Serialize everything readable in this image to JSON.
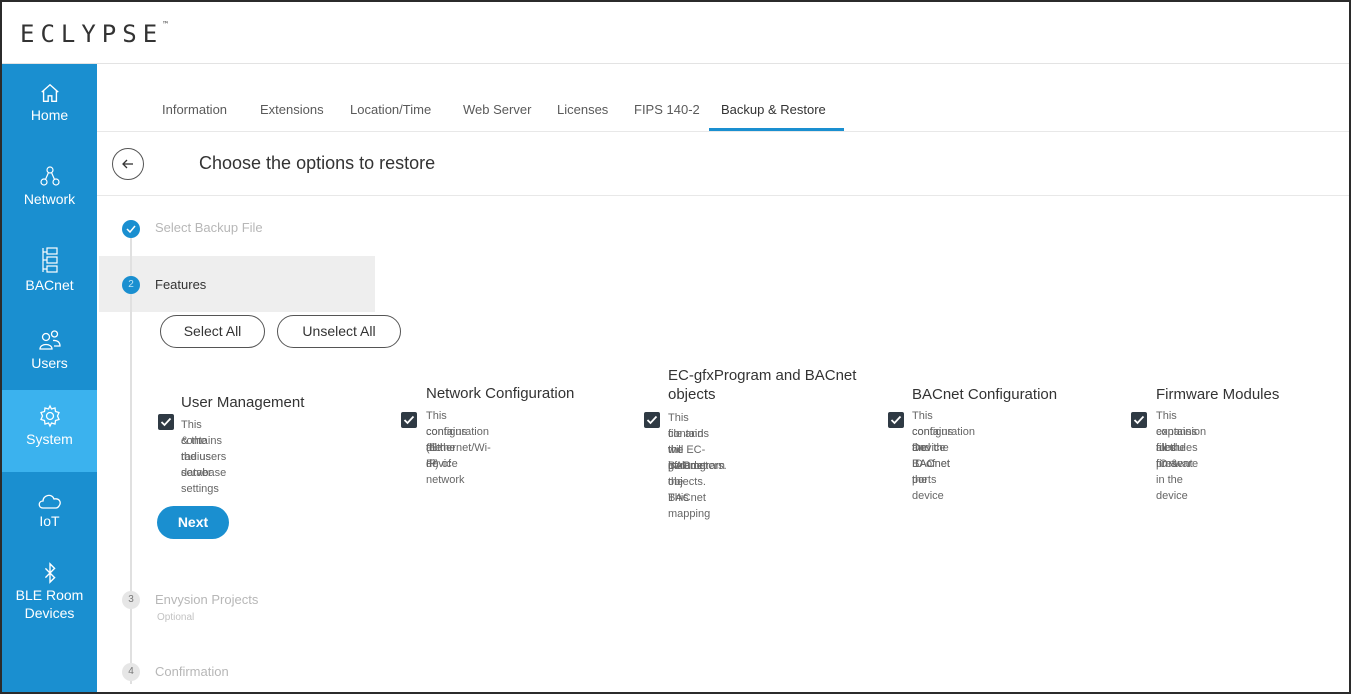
{
  "app": {
    "logo": "ECLYPSE",
    "logo_tm": "™"
  },
  "sidebar": {
    "items": [
      {
        "label": "Home"
      },
      {
        "label": "Network"
      },
      {
        "label": "BACnet"
      },
      {
        "label": "Users"
      },
      {
        "label": "System"
      },
      {
        "label": "IoT"
      },
      {
        "label": "BLE Room",
        "label2": "Devices"
      }
    ],
    "active": "System"
  },
  "tabs": [
    {
      "label": "Information"
    },
    {
      "label": "Extensions"
    },
    {
      "label": "Location/Time"
    },
    {
      "label": "Web Server"
    },
    {
      "label": "Licenses"
    },
    {
      "label": "FIPS 140-2"
    },
    {
      "label": "Backup & Restore"
    }
  ],
  "active_tab": "Backup & Restore",
  "page": {
    "title": "Choose the options to restore"
  },
  "steps": [
    {
      "number": "✓",
      "label": "Select Backup File",
      "state": "done"
    },
    {
      "number": "2",
      "label": "Features",
      "state": "active"
    },
    {
      "number": "3",
      "label": "Envysion Projects",
      "sub": "Optional",
      "state": "pending"
    },
    {
      "number": "4",
      "label": "Confirmation",
      "state": "pending"
    }
  ],
  "buttons": {
    "select_all": "Select All",
    "unselect_all": "Unselect All",
    "next": "Next"
  },
  "options": [
    {
      "title": "User Management",
      "desc": [
        "This contains the users database",
        "& the radius server settings"
      ],
      "checked": true
    },
    {
      "title": "Network Configuration",
      "desc": [
        "This contains all the IP network",
        "configuration (Ethernet/Wi-Fi) of",
        "the device"
      ],
      "checked": true
    },
    {
      "title": "EC-gfxProgram and BACnet objects",
      "desc": [
        "This contains the EC-gfxProgram",
        "file and the BACnet objects. This",
        "will include the BACnet mapping",
        "parameters."
      ],
      "checked": true
    },
    {
      "title": "BACnet Configuration",
      "desc": [
        "This contains the BACnet ports",
        "configuration and the BACnet",
        "Device ID of the device"
      ],
      "checked": true
    },
    {
      "title": "Firmware Modules",
      "desc": [
        "This contains all the IO &",
        "expansion modules firmware",
        "files present in the device"
      ],
      "checked": true
    }
  ],
  "colors": {
    "sidebar": "#1a8fd0",
    "sidebar_active": "#3bb2ee",
    "accent": "#1a8fd0"
  }
}
